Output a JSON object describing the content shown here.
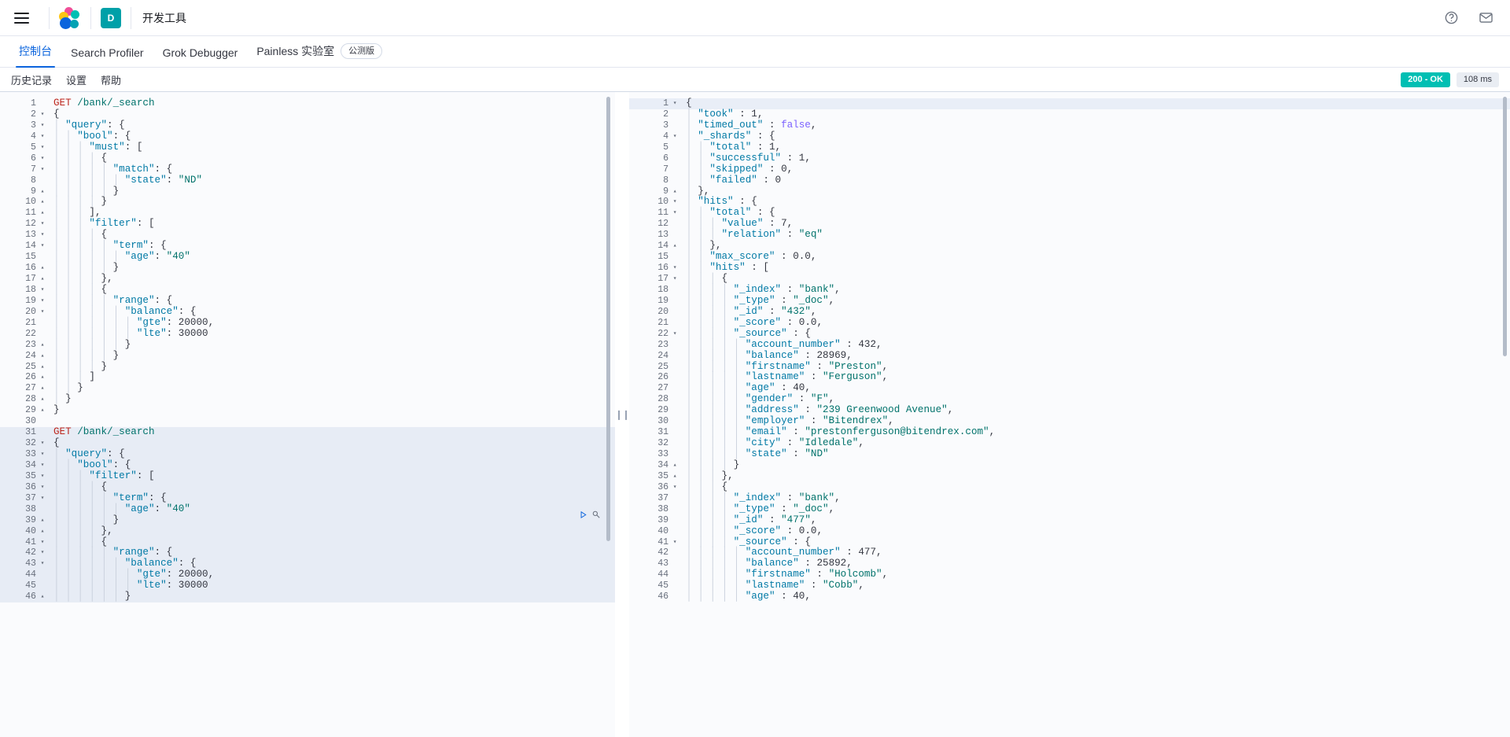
{
  "chrome": {
    "menu_icon": "hamburger-menu-icon",
    "logo_icon": "elastic-logo-icon",
    "space_initial": "D",
    "app_title": "开发工具",
    "help_icon": "help-circle-icon",
    "mail_icon": "mail-icon"
  },
  "tabs": [
    {
      "label": "控制台",
      "active": true,
      "badge": ""
    },
    {
      "label": "Search Profiler",
      "active": false,
      "badge": ""
    },
    {
      "label": "Grok Debugger",
      "active": false,
      "badge": ""
    },
    {
      "label": "Painless 实验室",
      "active": false,
      "badge": "公测版"
    }
  ],
  "consolebar": {
    "links": [
      "历史记录",
      "设置",
      "帮助"
    ],
    "status": "200 - OK",
    "status_color": "#00bfb3",
    "time": "108 ms"
  },
  "editor": {
    "request_actions": {
      "play_icon": "play-triangle-icon",
      "wrench_icon": "wrench-icon"
    },
    "splitter_icon": "vertical-drag-handle-icon",
    "request_lines": [
      {
        "n": 1,
        "fold": "",
        "text": "GET /bank/_search",
        "type": "req",
        "hl": false
      },
      {
        "n": 2,
        "fold": "▾",
        "text": "{",
        "hl": false
      },
      {
        "n": 3,
        "fold": "▾",
        "text": "  \"query\": {",
        "hl": false
      },
      {
        "n": 4,
        "fold": "▾",
        "text": "    \"bool\": {",
        "hl": false
      },
      {
        "n": 5,
        "fold": "▾",
        "text": "      \"must\": [",
        "hl": false
      },
      {
        "n": 6,
        "fold": "▾",
        "text": "        {",
        "hl": false
      },
      {
        "n": 7,
        "fold": "▾",
        "text": "          \"match\": {",
        "hl": false
      },
      {
        "n": 8,
        "fold": "",
        "text": "            \"state\": \"ND\"",
        "hl": false
      },
      {
        "n": 9,
        "fold": "▴",
        "text": "          }",
        "hl": false
      },
      {
        "n": 10,
        "fold": "▴",
        "text": "        }",
        "hl": false
      },
      {
        "n": 11,
        "fold": "▴",
        "text": "      ],",
        "hl": false
      },
      {
        "n": 12,
        "fold": "▾",
        "text": "      \"filter\": [",
        "hl": false
      },
      {
        "n": 13,
        "fold": "▾",
        "text": "        {",
        "hl": false
      },
      {
        "n": 14,
        "fold": "▾",
        "text": "          \"term\": {",
        "hl": false
      },
      {
        "n": 15,
        "fold": "",
        "text": "            \"age\": \"40\"",
        "hl": false
      },
      {
        "n": 16,
        "fold": "▴",
        "text": "          }",
        "hl": false
      },
      {
        "n": 17,
        "fold": "▴",
        "text": "        },",
        "hl": false
      },
      {
        "n": 18,
        "fold": "▾",
        "text": "        {",
        "hl": false
      },
      {
        "n": 19,
        "fold": "▾",
        "text": "          \"range\": {",
        "hl": false
      },
      {
        "n": 20,
        "fold": "▾",
        "text": "            \"balance\": {",
        "hl": false
      },
      {
        "n": 21,
        "fold": "",
        "text": "              \"gte\": 20000,",
        "hl": false
      },
      {
        "n": 22,
        "fold": "",
        "text": "              \"lte\": 30000",
        "hl": false
      },
      {
        "n": 23,
        "fold": "▴",
        "text": "            }",
        "hl": false
      },
      {
        "n": 24,
        "fold": "▴",
        "text": "          }",
        "hl": false
      },
      {
        "n": 25,
        "fold": "▴",
        "text": "        }",
        "hl": false
      },
      {
        "n": 26,
        "fold": "▴",
        "text": "      ]",
        "hl": false
      },
      {
        "n": 27,
        "fold": "▴",
        "text": "    }",
        "hl": false
      },
      {
        "n": 28,
        "fold": "▴",
        "text": "  }",
        "hl": false
      },
      {
        "n": 29,
        "fold": "▴",
        "text": "}",
        "hl": false
      },
      {
        "n": 30,
        "fold": "",
        "text": "",
        "hl": false
      },
      {
        "n": 31,
        "fold": "",
        "text": "GET /bank/_search",
        "type": "req",
        "hl": true
      },
      {
        "n": 32,
        "fold": "▾",
        "text": "{",
        "hl": true
      },
      {
        "n": 33,
        "fold": "▾",
        "text": "  \"query\": {",
        "hl": true
      },
      {
        "n": 34,
        "fold": "▾",
        "text": "    \"bool\": {",
        "hl": true
      },
      {
        "n": 35,
        "fold": "▾",
        "text": "      \"filter\": [",
        "hl": true
      },
      {
        "n": 36,
        "fold": "▾",
        "text": "        {",
        "hl": true
      },
      {
        "n": 37,
        "fold": "▾",
        "text": "          \"term\": {",
        "hl": true
      },
      {
        "n": 38,
        "fold": "",
        "text": "            \"age\": \"40\"",
        "hl": true
      },
      {
        "n": 39,
        "fold": "▴",
        "text": "          }",
        "hl": true
      },
      {
        "n": 40,
        "fold": "▴",
        "text": "        },",
        "hl": true
      },
      {
        "n": 41,
        "fold": "▾",
        "text": "        {",
        "hl": true
      },
      {
        "n": 42,
        "fold": "▾",
        "text": "          \"range\": {",
        "hl": true
      },
      {
        "n": 43,
        "fold": "▾",
        "text": "            \"balance\": {",
        "hl": true
      },
      {
        "n": 44,
        "fold": "",
        "text": "              \"gte\": 20000,",
        "hl": true
      },
      {
        "n": 45,
        "fold": "",
        "text": "              \"lte\": 30000",
        "hl": true
      },
      {
        "n": 46,
        "fold": "▴",
        "text": "            }",
        "hl": true
      }
    ],
    "response_lines": [
      {
        "n": 1,
        "fold": "▾",
        "text": "{",
        "cur": true
      },
      {
        "n": 2,
        "fold": "",
        "text": "  \"took\" : 1,"
      },
      {
        "n": 3,
        "fold": "",
        "text": "  \"timed_out\" : false,"
      },
      {
        "n": 4,
        "fold": "▾",
        "text": "  \"_shards\" : {"
      },
      {
        "n": 5,
        "fold": "",
        "text": "    \"total\" : 1,"
      },
      {
        "n": 6,
        "fold": "",
        "text": "    \"successful\" : 1,"
      },
      {
        "n": 7,
        "fold": "",
        "text": "    \"skipped\" : 0,"
      },
      {
        "n": 8,
        "fold": "",
        "text": "    \"failed\" : 0"
      },
      {
        "n": 9,
        "fold": "▴",
        "text": "  },"
      },
      {
        "n": 10,
        "fold": "▾",
        "text": "  \"hits\" : {"
      },
      {
        "n": 11,
        "fold": "▾",
        "text": "    \"total\" : {"
      },
      {
        "n": 12,
        "fold": "",
        "text": "      \"value\" : 7,"
      },
      {
        "n": 13,
        "fold": "",
        "text": "      \"relation\" : \"eq\""
      },
      {
        "n": 14,
        "fold": "▴",
        "text": "    },"
      },
      {
        "n": 15,
        "fold": "",
        "text": "    \"max_score\" : 0.0,"
      },
      {
        "n": 16,
        "fold": "▾",
        "text": "    \"hits\" : ["
      },
      {
        "n": 17,
        "fold": "▾",
        "text": "      {"
      },
      {
        "n": 18,
        "fold": "",
        "text": "        \"_index\" : \"bank\","
      },
      {
        "n": 19,
        "fold": "",
        "text": "        \"_type\" : \"_doc\","
      },
      {
        "n": 20,
        "fold": "",
        "text": "        \"_id\" : \"432\","
      },
      {
        "n": 21,
        "fold": "",
        "text": "        \"_score\" : 0.0,"
      },
      {
        "n": 22,
        "fold": "▾",
        "text": "        \"_source\" : {"
      },
      {
        "n": 23,
        "fold": "",
        "text": "          \"account_number\" : 432,"
      },
      {
        "n": 24,
        "fold": "",
        "text": "          \"balance\" : 28969,"
      },
      {
        "n": 25,
        "fold": "",
        "text": "          \"firstname\" : \"Preston\","
      },
      {
        "n": 26,
        "fold": "",
        "text": "          \"lastname\" : \"Ferguson\","
      },
      {
        "n": 27,
        "fold": "",
        "text": "          \"age\" : 40,"
      },
      {
        "n": 28,
        "fold": "",
        "text": "          \"gender\" : \"F\","
      },
      {
        "n": 29,
        "fold": "",
        "text": "          \"address\" : \"239 Greenwood Avenue\","
      },
      {
        "n": 30,
        "fold": "",
        "text": "          \"employer\" : \"Bitendrex\","
      },
      {
        "n": 31,
        "fold": "",
        "text": "          \"email\" : \"prestonferguson@bitendrex.com\","
      },
      {
        "n": 32,
        "fold": "",
        "text": "          \"city\" : \"Idledale\","
      },
      {
        "n": 33,
        "fold": "",
        "text": "          \"state\" : \"ND\""
      },
      {
        "n": 34,
        "fold": "▴",
        "text": "        }"
      },
      {
        "n": 35,
        "fold": "▴",
        "text": "      },"
      },
      {
        "n": 36,
        "fold": "▾",
        "text": "      {"
      },
      {
        "n": 37,
        "fold": "",
        "text": "        \"_index\" : \"bank\","
      },
      {
        "n": 38,
        "fold": "",
        "text": "        \"_type\" : \"_doc\","
      },
      {
        "n": 39,
        "fold": "",
        "text": "        \"_id\" : \"477\","
      },
      {
        "n": 40,
        "fold": "",
        "text": "        \"_score\" : 0.0,"
      },
      {
        "n": 41,
        "fold": "▾",
        "text": "        \"_source\" : {"
      },
      {
        "n": 42,
        "fold": "",
        "text": "          \"account_number\" : 477,"
      },
      {
        "n": 43,
        "fold": "",
        "text": "          \"balance\" : 25892,"
      },
      {
        "n": 44,
        "fold": "",
        "text": "          \"firstname\" : \"Holcomb\","
      },
      {
        "n": 45,
        "fold": "",
        "text": "          \"lastname\" : \"Cobb\","
      },
      {
        "n": 46,
        "fold": "",
        "text": "          \"age\" : 40,"
      }
    ]
  }
}
